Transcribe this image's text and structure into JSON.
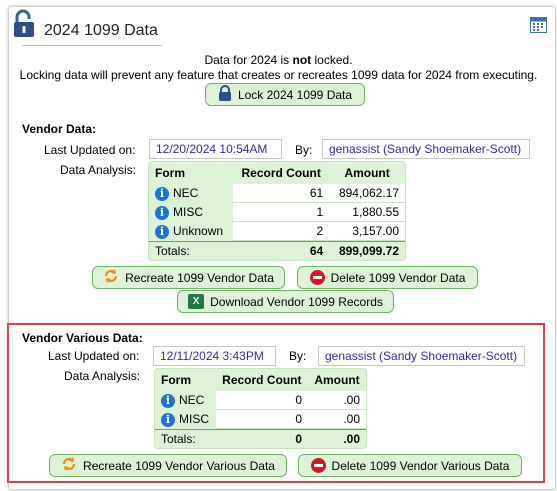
{
  "header": {
    "title": "2024 1099 Data"
  },
  "lock_status": {
    "line1_prefix": "Data for 2024 is ",
    "line1_bold": "not",
    "line1_suffix": " locked.",
    "line2": "Locking data will prevent any feature that creates or recreates 1099 data for 2024 from executing.",
    "lock_button": "Lock 2024 1099 Data"
  },
  "vendor": {
    "title": "Vendor Data:",
    "last_updated_label": "Last Updated on:",
    "last_updated": "12/20/2024 10:54AM",
    "by_label": "By:",
    "by": "genassist (Sandy Shoemaker-Scott)",
    "analysis_label": "Data Analysis:",
    "columns": [
      "Form",
      "Record Count",
      "Amount"
    ],
    "rows": [
      {
        "form": "NEC",
        "count": "61",
        "amount": "894,062.17"
      },
      {
        "form": "MISC",
        "count": "1",
        "amount": "1,880.55"
      },
      {
        "form": "Unknown",
        "count": "2",
        "amount": "3,157.00"
      }
    ],
    "totals": {
      "label": "Totals:",
      "count": "64",
      "amount": "899,099.72"
    },
    "recreate_button": "Recreate 1099 Vendor Data",
    "delete_button": "Delete 1099 Vendor Data",
    "download_button": "Download Vendor 1099 Records"
  },
  "various": {
    "title": "Vendor Various Data:",
    "last_updated_label": "Last Updated on:",
    "last_updated": "12/11/2024 3:43PM",
    "by_label": "By:",
    "by": "genassist (Sandy Shoemaker-Scott)",
    "analysis_label": "Data Analysis:",
    "columns": [
      "Form",
      "Record Count",
      "Amount"
    ],
    "rows": [
      {
        "form": "NEC",
        "count": "0",
        "amount": ".00"
      },
      {
        "form": "MISC",
        "count": "0",
        "amount": ".00"
      }
    ],
    "totals": {
      "label": "Totals:",
      "count": "0",
      "amount": ".00"
    },
    "recreate_button": "Recreate 1099 Vendor Various Data",
    "delete_button": "Delete 1099 Vendor Various Data"
  },
  "colors": {
    "button_bg": "#ddf2d7",
    "button_border": "#6fb563",
    "highlight": "#e14141",
    "info": "#1e74d6",
    "field_text": "#3a2a9c"
  },
  "icons": [
    "unlock-icon",
    "calendar-icon",
    "lock-icon",
    "info-icon",
    "recreate-icon",
    "delete-icon",
    "excel-icon"
  ]
}
